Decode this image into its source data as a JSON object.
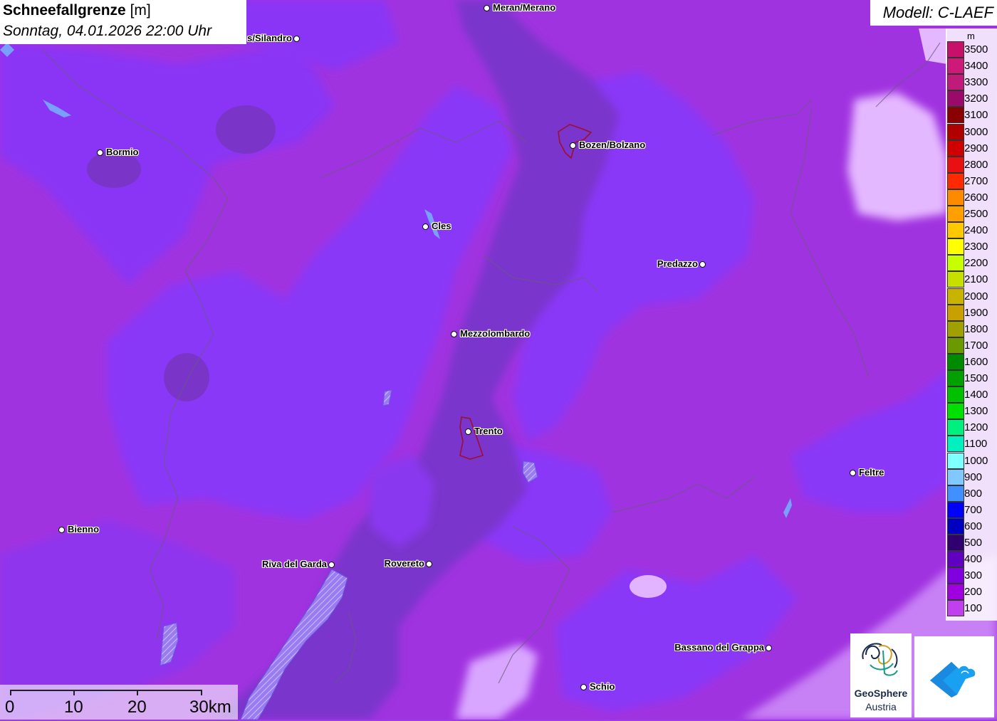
{
  "title": {
    "bold": "Schneefallgrenze",
    "unit": " [m]",
    "datetime": "Sonntag, 04.01.2026 22:00 Uhr"
  },
  "model": "Modell: C-LAEF",
  "legend": {
    "unit": "m",
    "items": [
      {
        "label": "3500",
        "color": "#c8106a"
      },
      {
        "label": "3400",
        "color": "#cd1a78"
      },
      {
        "label": "3300",
        "color": "#c01a7a"
      },
      {
        "label": "3200",
        "color": "#9a0a6a"
      },
      {
        "label": "3100",
        "color": "#8a0000"
      },
      {
        "label": "3000",
        "color": "#b00000"
      },
      {
        "label": "2900",
        "color": "#d00000"
      },
      {
        "label": "2800",
        "color": "#e81010"
      },
      {
        "label": "2700",
        "color": "#ff2a00"
      },
      {
        "label": "2600",
        "color": "#ff8a00"
      },
      {
        "label": "2500",
        "color": "#ffa000"
      },
      {
        "label": "2400",
        "color": "#ffc800"
      },
      {
        "label": "2300",
        "color": "#ffff00"
      },
      {
        "label": "2200",
        "color": "#c8ff00"
      },
      {
        "label": "2100",
        "color": "#c8e000"
      },
      {
        "label": "2000",
        "color": "#c8b400"
      },
      {
        "label": "1900",
        "color": "#c8a000"
      },
      {
        "label": "1800",
        "color": "#a0a000"
      },
      {
        "label": "1700",
        "color": "#6a9a00"
      },
      {
        "label": "1600",
        "color": "#008a00"
      },
      {
        "label": "1500",
        "color": "#00a000"
      },
      {
        "label": "1400",
        "color": "#00c000"
      },
      {
        "label": "1300",
        "color": "#00e000"
      },
      {
        "label": "1200",
        "color": "#00f080"
      },
      {
        "label": "1100",
        "color": "#00f0c0"
      },
      {
        "label": "1000",
        "color": "#80ffff"
      },
      {
        "label": "900",
        "color": "#80c8ff"
      },
      {
        "label": "800",
        "color": "#4090ff"
      },
      {
        "label": "700",
        "color": "#0000ff"
      },
      {
        "label": "600",
        "color": "#0000c0"
      },
      {
        "label": "500",
        "color": "#300070"
      },
      {
        "label": "400",
        "color": "#6000c0"
      },
      {
        "label": "300",
        "color": "#8000e0"
      },
      {
        "label": "200",
        "color": "#a000e0"
      },
      {
        "label": "100",
        "color": "#c040f0"
      }
    ]
  },
  "cities": [
    {
      "name": "Meran/Merano",
      "side": "right"
    },
    {
      "name": "s/Silandro",
      "side": "left"
    },
    {
      "name": "Bormio",
      "side": "right"
    },
    {
      "name": "Bozen/Bolzano",
      "side": "right"
    },
    {
      "name": "Cles",
      "side": "right"
    },
    {
      "name": "Predazzo",
      "side": "left"
    },
    {
      "name": "Mezzolombardo",
      "side": "right"
    },
    {
      "name": "Trento",
      "side": "right"
    },
    {
      "name": "Feltre",
      "side": "right"
    },
    {
      "name": "Bienno",
      "side": "right"
    },
    {
      "name": "Riva del Garda",
      "side": "left"
    },
    {
      "name": "Rovereto",
      "side": "left"
    },
    {
      "name": "Bassano del Grappa",
      "side": "left"
    },
    {
      "name": "Schio",
      "side": "right"
    }
  ],
  "scale": {
    "labels": [
      "0",
      "10",
      "20",
      "30km"
    ]
  },
  "logos": {
    "geosphere_line1": "GeoSphere",
    "geosphere_line2": "Austria"
  }
}
